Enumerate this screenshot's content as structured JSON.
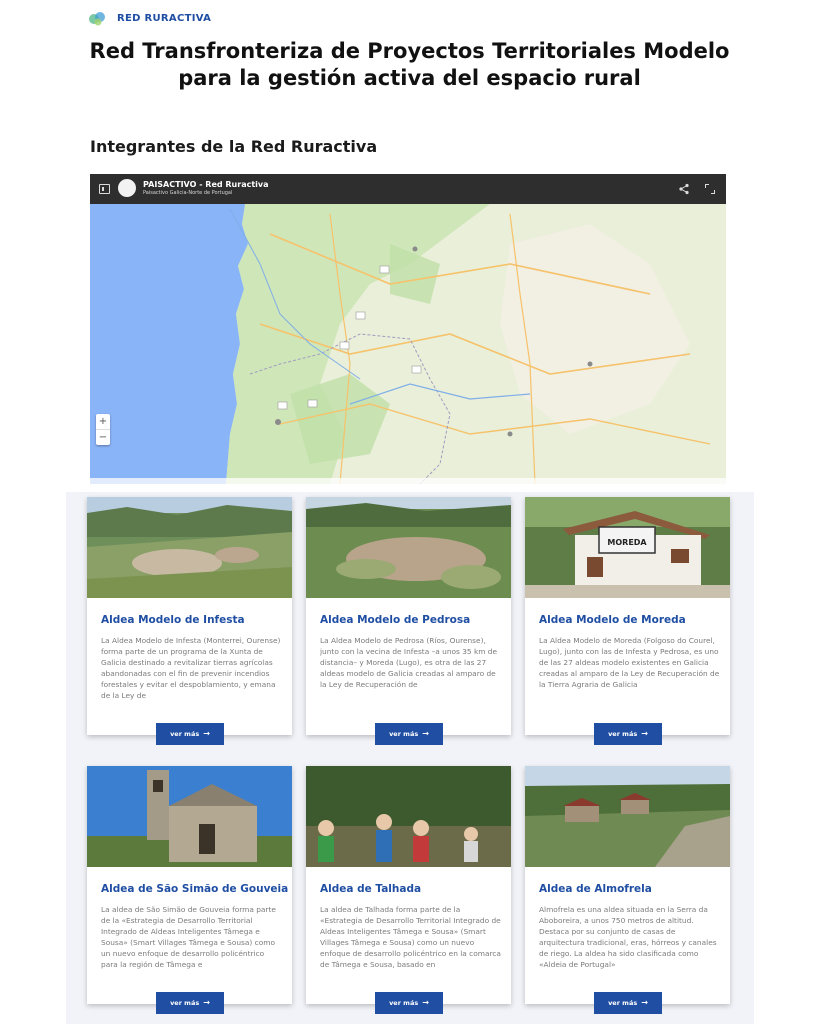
{
  "header": {
    "brand": "RED RURACTIVA",
    "title_line1": "Red Transfronteriza de Proyectos Territoriales Modelo",
    "title_line2": "para la gestión activa del espacio rural"
  },
  "section": {
    "title": "Integrantes de la Red Ruractiva"
  },
  "map": {
    "title": "PAISACTIVO - Red Ruractiva",
    "subtitle": "Paisactivo Galicia-Norte de Portugal",
    "zoom_in": "+",
    "zoom_out": "−"
  },
  "cards": [
    {
      "title": "Aldea Modelo de Infesta",
      "text": "La Aldea Modelo de Infesta (Monterrei, Ourense) forma parte de un programa de la Xunta de Galicia destinado a revitalizar tierras agrícolas abandonadas con el fin de prevenir incendios forestales y evitar el despoblamiento, y emana de la Ley de",
      "button": "ver más"
    },
    {
      "title": "Aldea Modelo de Pedrosa",
      "text": "La Aldea Modelo de Pedrosa (Ríos, Ourense), junto con la vecina de Infesta –a unos 35 km de distancia– y Moreda (Lugo), es otra de las 27 aldeas modelo de Galicia creadas al amparo de la Ley de Recuperación de",
      "button": "ver más"
    },
    {
      "title": "Aldea Modelo de Moreda",
      "text": "La Aldea Modelo de Moreda (Folgoso do Courel, Lugo), junto con las de Infesta y Pedrosa, es uno de las 27 aldeas modelo existentes en Galicia creadas al amparo de la Ley de Recuperación de la Tierra Agraria de Galicia",
      "button": "ver más",
      "sign": "MOREDA"
    },
    {
      "title": "Aldea de São Simão de Gouveia",
      "text": "La aldea de São Simão de Gouveia forma parte de la «Estrategia de Desarrollo Territorial Integrado de Aldeas Inteligentes Tâmega e Sousa» (Smart Villages Tâmega e Sousa) como un nuevo enfoque de desarrollo policéntrico para la región de Tâmega e",
      "button": "ver más"
    },
    {
      "title": "Aldea de Talhada",
      "text": "La aldea de Talhada forma parte de la «Estrategia de Desarrollo Territorial Integrado de Aldeas Inteligentes Tâmega e Sousa» (Smart Villages Tâmega e Sousa) como un nuevo enfoque de desarrollo policéntrico en la comarca de Tâmega e Sousa, basado en",
      "button": "ver más"
    },
    {
      "title": "Aldea de Almofrela",
      "text": "Almofrela es una aldea situada en la Serra da Aboboreira, a unos 750 metros de altitud. Destaca por su conjunto de casas de arquitectura tradicional, eras, hórreos y canales de riego. La aldea ha sido clasificada como «Aldeia de Portugal»",
      "button": "ver más"
    }
  ],
  "colors": {
    "brand_blue": "#1f4ea3",
    "map_bar": "#2e2e2e",
    "sea": "#8ab4f8",
    "land": "#e9efd9"
  }
}
